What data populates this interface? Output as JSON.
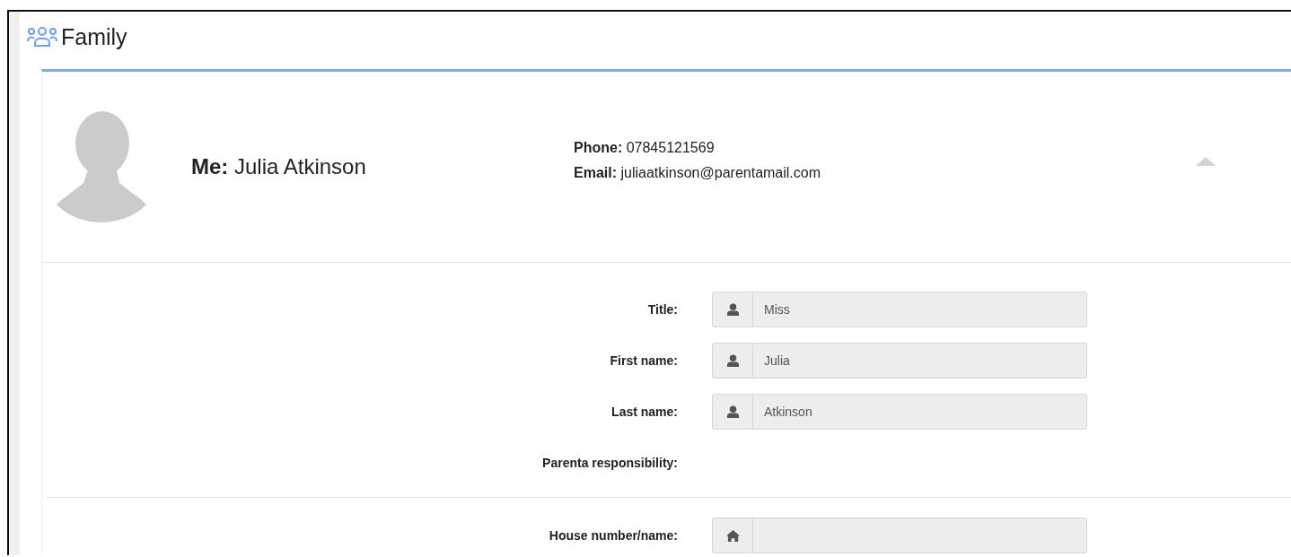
{
  "header": {
    "title": "Family"
  },
  "profile": {
    "label": "Me:",
    "name": "Julia Atkinson",
    "expanded": true,
    "contacts": [
      {
        "label": "Phone:",
        "value": "07845121569"
      },
      {
        "label": "Email:",
        "value": "juliaatkinson@parentamail.com"
      }
    ]
  },
  "sections": [
    {
      "rows": [
        {
          "label": "Title:",
          "kind": "person",
          "value": "Miss"
        },
        {
          "label": "First name:",
          "kind": "person",
          "value": "Julia"
        },
        {
          "label": "Last name:",
          "kind": "person",
          "value": "Atkinson"
        },
        {
          "label": "Parenta responsibility:",
          "kind": "text"
        }
      ]
    },
    {
      "rows": [
        {
          "label": "House number/name:",
          "kind": "home"
        }
      ]
    }
  ]
}
